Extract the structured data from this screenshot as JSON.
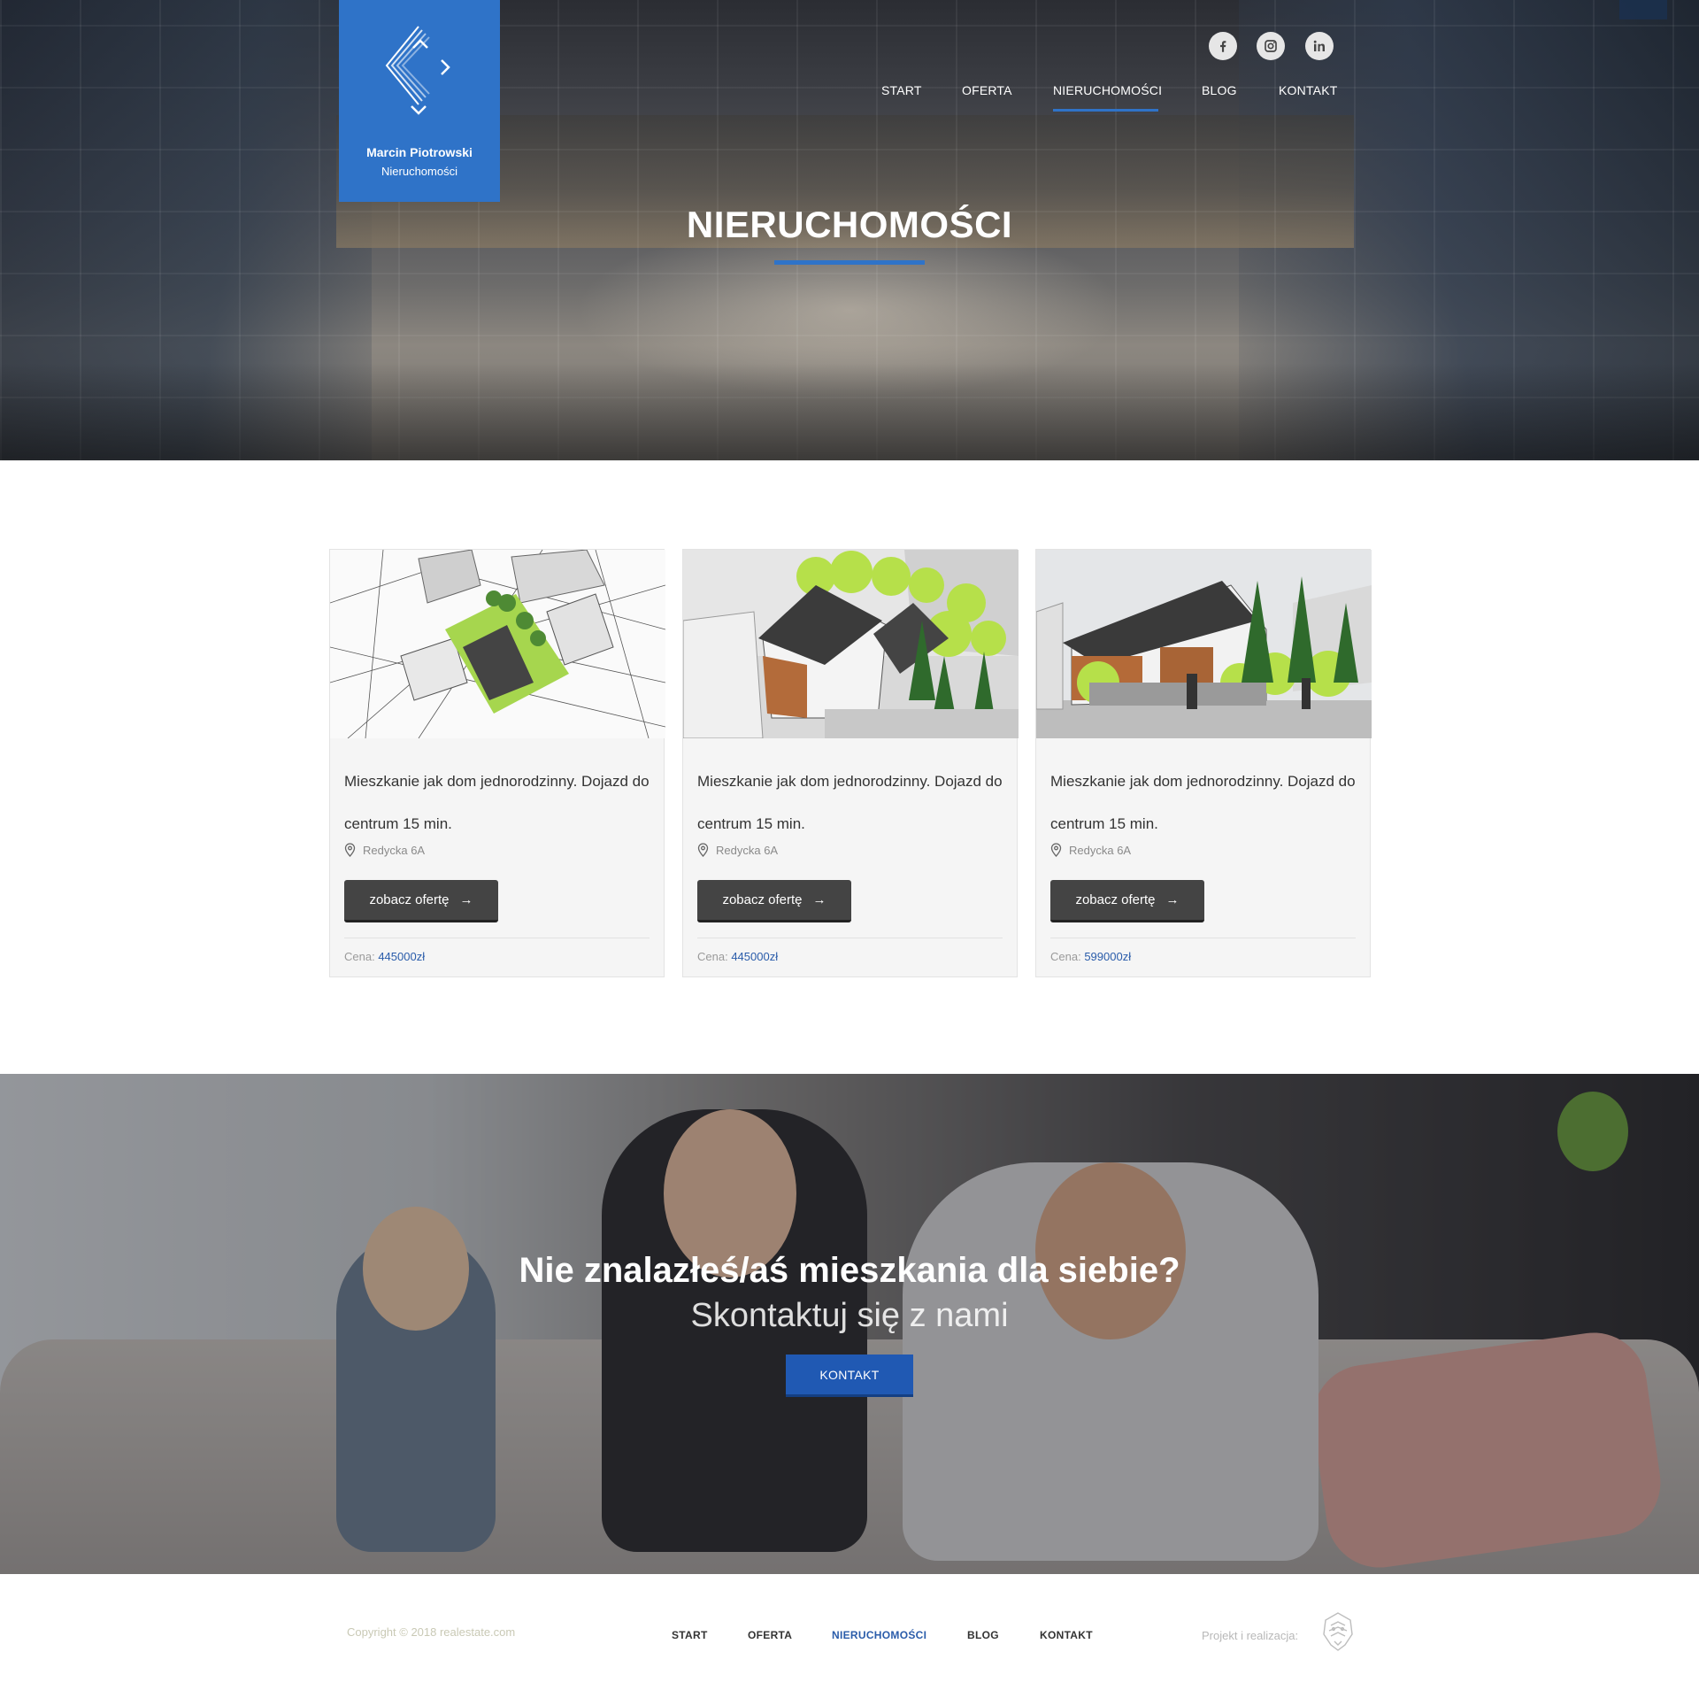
{
  "brand": {
    "name": "Marcin Piotrowski",
    "subtitle": "Nieruchomości",
    "accent": "#2f73c8"
  },
  "social": [
    {
      "icon": "facebook-icon"
    },
    {
      "icon": "instagram-icon"
    },
    {
      "icon": "linkedin-icon"
    }
  ],
  "nav": {
    "items": [
      {
        "label": "START"
      },
      {
        "label": "OFERTA"
      },
      {
        "label": "NIERUCHOMOŚCI",
        "active": true
      },
      {
        "label": "BLOG"
      },
      {
        "label": "KONTAKT"
      }
    ]
  },
  "hero": {
    "title": "NIERUCHOMOŚCI"
  },
  "listings": [
    {
      "description": "Mieszkanie jak dom jednorodzinny. Dojazd do centrum 15 min.",
      "address": "Redycka 6A",
      "button_label": "zobacz ofertę",
      "price_label": "Cena:",
      "price": "445000zł"
    },
    {
      "description": "Mieszkanie jak dom jednorodzinny. Dojazd do centrum 15 min.",
      "address": "Redycka 6A",
      "button_label": "zobacz ofertę",
      "price_label": "Cena:",
      "price": "445000zł"
    },
    {
      "description": "Mieszkanie jak dom jednorodzinny. Dojazd do centrum 15 min.",
      "address": "Redycka 6A",
      "button_label": "zobacz ofertę",
      "price_label": "Cena:",
      "price": "599000zł"
    }
  ],
  "banner": {
    "title": "Nie znalazłeś/aś mieszkania dla siebie?",
    "subtitle": "Skontaktuj się z nami",
    "button_label": "KONTAKT",
    "button_color": "#2059b3"
  },
  "footer": {
    "copyright": "Copyright © 2018 realestate.com",
    "nav": [
      {
        "label": "START"
      },
      {
        "label": "OFERTA"
      },
      {
        "label": "NIERUCHOMOŚCI",
        "active": true
      },
      {
        "label": "BLOG"
      },
      {
        "label": "KONTAKT"
      }
    ],
    "credit_label": "Projekt i realizacja:"
  }
}
